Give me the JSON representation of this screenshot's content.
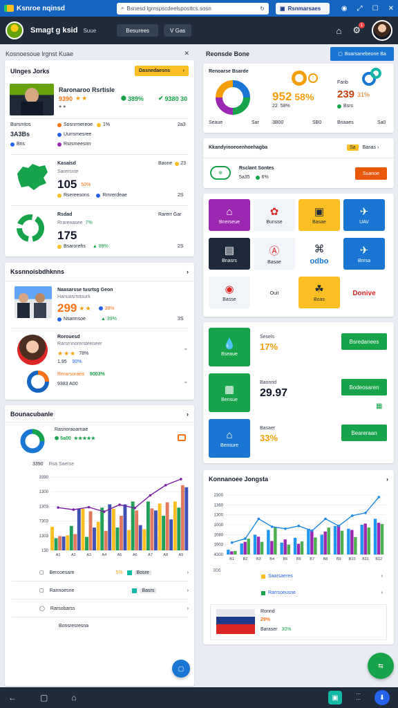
{
  "browser": {
    "app_name": "Ksnroe nqinsd",
    "url": "Bsnesd lgrnspscdeelsposttcs.sosn",
    "tab_label": "Rsnmarsaes"
  },
  "header": {
    "title": "Smagt g ksid",
    "subtitle": "Suue",
    "dropdown1": "Besurees",
    "dropdown2": "V Gas",
    "notification_count": "1"
  },
  "left_panel": {
    "header_title": "Kosnoesoue lrgnst Kuae",
    "people_card": {
      "title": "Ulnges Jorks",
      "action_label": "Dasnedaesns",
      "person_name": "Raronaroo Rsrtisle",
      "person_rating": "9390",
      "stat1": "389%",
      "stat2": "9380 30",
      "row1_label": "Bursmtos",
      "row1_value": "3A3Bs",
      "row1_sub": "Bns",
      "r1": "Sosnrmereoe",
      "r1b": "Uurrsmesree",
      "r1c": "Rsrsmeesnn",
      "r1_pct": "1%",
      "r1_val": "2a3",
      "region_title": "Kasaisd",
      "region_sub": "Sarersnte",
      "region_value": "105",
      "region_pct": "50%",
      "region_foot1": "Rsereesons",
      "region_foot2": "Rrnrerdeae",
      "region_right": "Baone",
      "region_right_val": "23",
      "region_right_n": "2S",
      "recycle_title": "Rsdad",
      "recycle_sub": "Rrarenasee",
      "recycle_pct": "7%",
      "recycle_value": "175",
      "recycle_foot1": "Bsarorehs",
      "recycle_foot2": "89%",
      "recycle_right": "Rarerr Gar",
      "recycle_right_n": "2S"
    },
    "team_card": {
      "title": "Kssnnoisbdhknns",
      "item1_name": "Naasarsse tusrtsg Geon",
      "item1_sub": "Hanuasrnrtsurk",
      "item1_value": "299",
      "item1_pct": "38%",
      "item1_foot1": "Nsarmsoe",
      "item1_foot2": "39%",
      "item1_n": "3S",
      "item2_name": "Rorouesd",
      "item2_sub": "Rarsrnnorersteeneer",
      "item2_rating": "78%",
      "item2_val": "1.95",
      "item2_val2": "90%",
      "item3_label": "Rerarsoraea",
      "item3_pct": "9003%",
      "item3_val": "9383 A00"
    },
    "sales_card": {
      "title": "Bounacubanle",
      "donut_label": "Rasnoraoarnae",
      "donut_val": "5a00",
      "stat_a": "3390",
      "stat_a_label": "Rsa Saerse"
    },
    "bottom_list": [
      {
        "label": "Bercoesare",
        "value": "5%",
        "tag": "Bosre"
      },
      {
        "label": "Rannoesne",
        "value": "",
        "tag": "Basrs"
      },
      {
        "label": "Rarsobarss",
        "value": "",
        "tag": ""
      },
      {
        "label": "Bonsresresna",
        "value": "",
        "tag": ""
      }
    ]
  },
  "right_panel": {
    "header_title": "Reonsde Bone",
    "header_action": "Boarsanebeone Ba",
    "stats_card": {
      "panel1_title": "Renoarse Bsarde",
      "panel1_foot1": "Seaue",
      "panel1_foot2": "Sar",
      "panel2_value": "952",
      "panel2_pct": "58%",
      "panel2_sub": "22",
      "panel2_sub_pct": "58%",
      "panel2_foot1": "3B00",
      "panel2_foot2": "SB0",
      "panel3_title": "Fanb",
      "panel3_value": "239",
      "panel3_pct": "31%",
      "panel3_sub": "Bsrs",
      "panel3_foot1": "Bnaaes",
      "panel3_foot2": "Sa0"
    },
    "promo_card": {
      "title": "Kkandyinoeoenhoehagba",
      "badge": "Sa",
      "action": "Basas",
      "item_title": "Rsclant Sontes",
      "item_value": "5a35",
      "item_pct": "6%",
      "item_button": "Suanoe"
    },
    "tiles": [
      {
        "label": "Bnerseue",
        "bg": "#9c27b0",
        "icon": "house-icon",
        "glyph": "⌂"
      },
      {
        "label": "Bunsse",
        "bg": "#f1f5f9",
        "icon": "tag-icon",
        "glyph": "✿"
      },
      {
        "label": "Basae",
        "bg": "#fbbf24",
        "icon": "badge-icon",
        "glyph": "▣"
      },
      {
        "label": "UAV",
        "bg": "#1976d2",
        "icon": "wing-icon",
        "glyph": "✈"
      },
      {
        "label": "Bnasrs",
        "bg": "#1e293b",
        "icon": "screen-icon",
        "glyph": "▤"
      },
      {
        "label": "Basae",
        "bg": "#f1f5f9",
        "icon": "bottle-icon",
        "glyph": "Ⓐ"
      },
      {
        "label": "odbo",
        "bg": "#ffffff",
        "icon": "brand-icon",
        "glyph": "⌘"
      },
      {
        "label": "Bnrsa",
        "bg": "#1976d2",
        "icon": "plane-icon",
        "glyph": "✈"
      },
      {
        "label": "Basse",
        "bg": "#f1f5f9",
        "icon": "square-icon",
        "glyph": "◉"
      },
      {
        "label": "Ouit",
        "bg": "#ffffff",
        "icon": "text-icon",
        "glyph": ""
      },
      {
        "label": "Boas",
        "bg": "#fbbf24",
        "icon": "vase-icon",
        "glyph": "☘"
      },
      {
        "label": "Donive",
        "bg": "#ffffff",
        "icon": "logo-icon",
        "glyph": ""
      }
    ],
    "actions_card": [
      {
        "tile_label": "Bseaue",
        "title": "Sesels",
        "value": "17%",
        "button": "Bsredanees",
        "icon": "drop-icon"
      },
      {
        "tile_label": "Bensue",
        "title": "Baonnd",
        "value": "29.97",
        "button": "Bodeosaren",
        "icon": "building-icon"
      },
      {
        "tile_label": "Bensure",
        "title": "Basaer",
        "value": "33%",
        "button": "Beareraan",
        "icon": "house-icon"
      }
    ],
    "chart_card": {
      "title": "Konnanoee Jongsta",
      "legend1": "Saarsaeres",
      "legend2": "Rarrsoeusne",
      "promo_title": "Ronnd",
      "promo_value": "29%",
      "promo_foot": "Baraser",
      "promo_foot_pct": "30%"
    }
  },
  "chart_data": [
    {
      "type": "bar",
      "categories": [
        "A1",
        "A2",
        "A3",
        "A4",
        "A5",
        "A6",
        "A7",
        "A8",
        "A9"
      ],
      "yticks": [
        "3390",
        "1300",
        "1303",
        "7303",
        "1303",
        "130"
      ],
      "series": [
        {
          "values": [
            580,
            370,
            1020,
            700,
            1020,
            500,
            520,
            1150,
            1200
          ],
          "color": "#fbbf24"
        },
        {
          "values": [
            300,
            600,
            330,
            1050,
            560,
            1200,
            1200,
            850,
            1050
          ],
          "color": "#22a05a"
        },
        {
          "values": [
            350,
            400,
            960,
            480,
            850,
            980,
            1030,
            1180,
            1600
          ],
          "color": "#e07a5f"
        },
        {
          "values": [
            340,
            1020,
            560,
            1130,
            1130,
            620,
            980,
            760,
            1550
          ],
          "color": "#3f51b5"
        }
      ],
      "line": [
        1050,
        1000,
        1060,
        950,
        1120,
        1040,
        1350,
        1600,
        1750
      ],
      "ylim": [
        0,
        1800
      ]
    },
    {
      "type": "bar",
      "categories": [
        "B1",
        "B2",
        "B3",
        "B4",
        "B5",
        "B6",
        "B7",
        "B8",
        "B9",
        "B10",
        "B11",
        "B12"
      ],
      "yticks": [
        "2300",
        "1360",
        "1300",
        "1000",
        "1080",
        "1003",
        "4300"
      ],
      "series": [
        {
          "values": [
            120,
            280,
            500,
            620,
            300,
            420,
            650,
            500,
            720,
            650,
            750,
            900
          ],
          "color": "#2196f3"
        },
        {
          "values": [
            80,
            320,
            450,
            340,
            380,
            270,
            600,
            580,
            750,
            620,
            780,
            800
          ],
          "color": "#9c27b0"
        },
        {
          "values": [
            90,
            400,
            320,
            700,
            250,
            330,
            430,
            680,
            600,
            440,
            680,
            770
          ],
          "color": "#4caf50"
        }
      ],
      "line": [
        300,
        400,
        900,
        700,
        650,
        720,
        600,
        900,
        720,
        980,
        1050,
        1450
      ],
      "ylim": [
        0,
        1500
      ]
    }
  ]
}
